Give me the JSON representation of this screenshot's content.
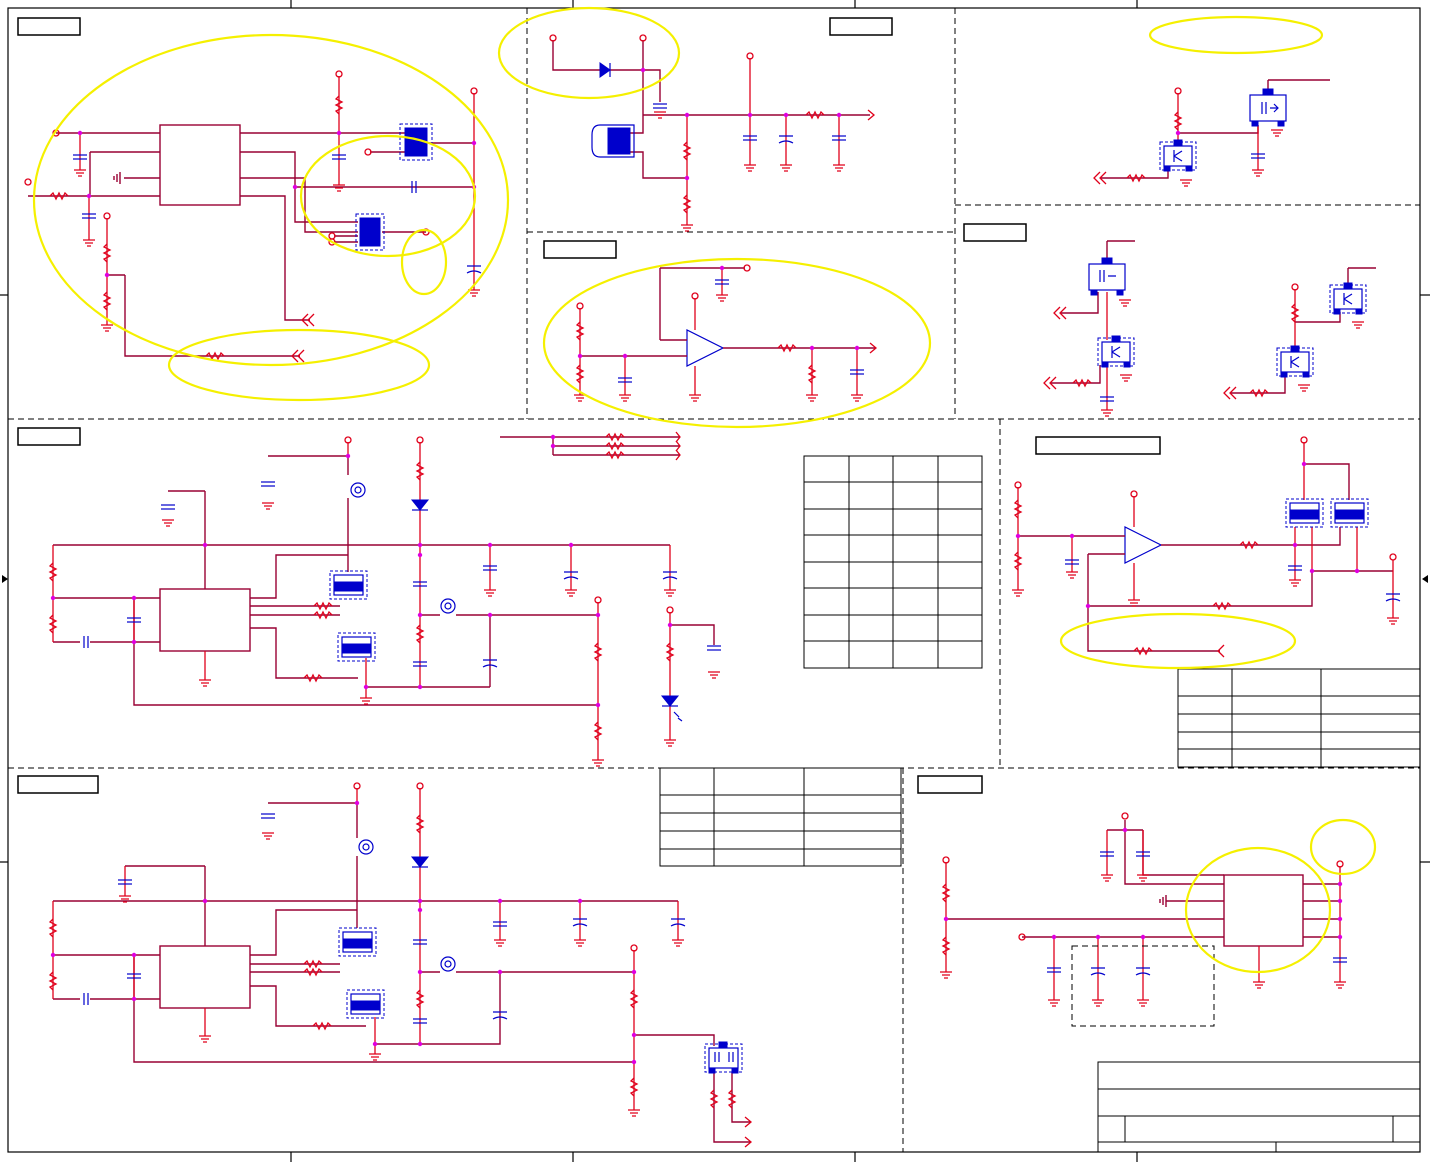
{
  "canvas": {
    "width": 1430,
    "height": 1162
  },
  "colors": {
    "wire": "#990033",
    "power": "#e0001b",
    "component": "#0000cc",
    "junction": "#e000e0",
    "highlight": "#f5f000",
    "frame": "#000000"
  },
  "sheet": {
    "blocks": [
      {
        "id": "block-1",
        "kind": "power-input-circuit"
      },
      {
        "id": "block-2",
        "kind": "regulator-circuit"
      },
      {
        "id": "block-3",
        "kind": "mosfet-switch"
      },
      {
        "id": "block-4",
        "kind": "transistor-switches"
      },
      {
        "id": "block-5",
        "kind": "op-amp-buffer"
      },
      {
        "id": "block-6",
        "kind": "dc-dc-converter"
      },
      {
        "id": "block-7",
        "kind": "op-amp-current-sense"
      },
      {
        "id": "block-8",
        "kind": "dc-dc-converter"
      },
      {
        "id": "block-9",
        "kind": "ic-with-decoupling"
      }
    ],
    "highlight_count": 11,
    "section_labels_blank": true,
    "tables_blank": true
  }
}
